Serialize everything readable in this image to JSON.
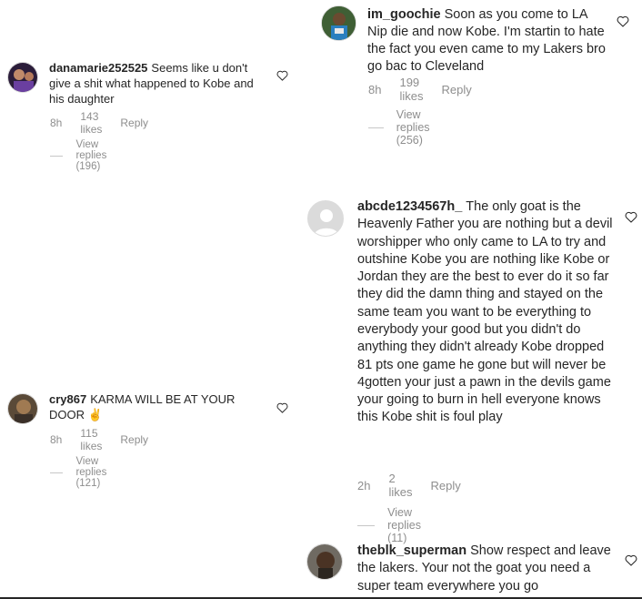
{
  "comments": [
    {
      "username": "im_goochie",
      "text": "Soon as you come to LA Nip die and now Kobe. I'm startin to hate the fact you even came to my Lakers bro go bac to Cleveland",
      "time": "8h",
      "likes": "199 likes",
      "reply_label": "Reply",
      "view_replies": "View replies (256)"
    },
    {
      "username": "danamarie252525",
      "text": "Seems like u don't give a shit what happened to Kobe and his daughter",
      "time": "8h",
      "likes": "143 likes",
      "reply_label": "Reply",
      "view_replies": "View replies (196)"
    },
    {
      "username": "abcde1234567h_",
      "text": "The only goat is the Heavenly Father you are nothing but a devil worshipper who only came to LA to try and outshine Kobe you are nothing like Kobe or Jordan they are the best to ever do it so far they did the damn thing and stayed on the same team you want to be everything to everybody your good but you didn't do anything they didn't already Kobe dropped 81 pts one game he gone but will never be 4gotten your just a pawn in the devils game your going to burn in hell everyone knows this Kobe shit is foul play",
      "time": "2h",
      "likes": "2 likes",
      "reply_label": "Reply",
      "view_replies": "View replies (11)"
    },
    {
      "username": "cry867",
      "text": "KARMA WILL BE AT YOUR DOOR ✌",
      "time": "8h",
      "likes": "115 likes",
      "reply_label": "Reply",
      "view_replies": "View replies (121)"
    },
    {
      "username": "theblk_superman",
      "text": "Show respect and leave the lakers. Your not the goat you need a super team everywhere you go"
    }
  ],
  "colors": {
    "text": "#262626",
    "meta": "#8e8e8e",
    "line": "#c7c7c7"
  },
  "icons": {
    "like": "heart-outline-icon",
    "default_avatar": "default-avatar-icon"
  }
}
